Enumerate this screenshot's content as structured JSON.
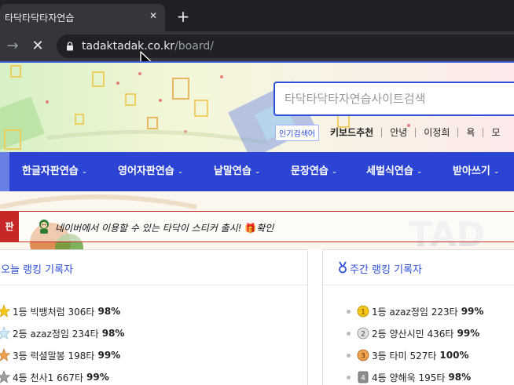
{
  "browser": {
    "tab_title": "타닥타닥타자연습",
    "close_glyph": "✕",
    "newtab_glyph": "+",
    "forward_glyph": "→",
    "stop_glyph": "✕",
    "url_host": "tadaktadak.co.kr",
    "url_path": "/board/"
  },
  "search": {
    "placeholder": "타닥타닥타자연습사이트검색"
  },
  "popular": {
    "badge": "인기검색어",
    "items": [
      "키보드추천",
      "안녕",
      "이정희",
      "욕",
      "모"
    ]
  },
  "nav": {
    "chevron": "⌄",
    "items": [
      "한글자판연습",
      "영어자판연습",
      "낱말연습",
      "문장연습",
      "세벌식연습",
      "받아쓰기"
    ]
  },
  "notice": {
    "tag": "판",
    "text": "네이버에서 이용할 수 있는 타닥이 스티커 출시!",
    "gift": "🎁",
    "link": "확인"
  },
  "ranking_today": {
    "title": "오늘 랭킹 기록자",
    "rows": [
      {
        "rank": "1등",
        "name": "빅뱅처럼",
        "speed": "306타",
        "accuracy": "98%"
      },
      {
        "rank": "2등",
        "name": "azaz정임",
        "speed": "234타",
        "accuracy": "98%"
      },
      {
        "rank": "3등",
        "name": "럭셜말봉",
        "speed": "198타",
        "accuracy": "99%"
      },
      {
        "rank": "4등",
        "name": "천사1",
        "speed": "667타",
        "accuracy": "99%"
      }
    ]
  },
  "ranking_weekly": {
    "title": "주간 랭킹 기록자",
    "rows": [
      {
        "rank": "1등",
        "name": "azaz정임",
        "speed": "223타",
        "accuracy": "99%"
      },
      {
        "rank": "2등",
        "name": "양산시민",
        "speed": "436타",
        "accuracy": "99%"
      },
      {
        "rank": "3등",
        "name": "타미",
        "speed": "527타",
        "accuracy": "100%"
      },
      {
        "rank": "4등",
        "name": "양해욱",
        "speed": "195타",
        "accuracy": "98%"
      }
    ]
  },
  "colors": {
    "nav_blue": "#2b44d3",
    "accent_blue": "#2f4fd9",
    "notice_red": "#c62828",
    "chrome_dark": "#202124",
    "chrome_tab": "#35363a"
  }
}
